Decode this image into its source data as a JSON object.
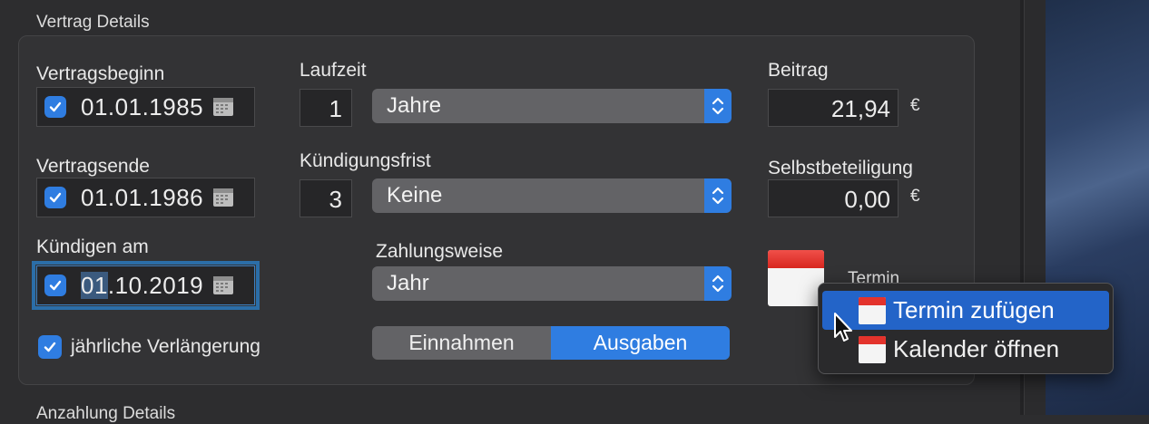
{
  "section": {
    "title": "Vertrag Details",
    "next_title": "Anzahlung Details"
  },
  "vertragsbeginn": {
    "label": "Vertragsbeginn",
    "date": "01.01.1985",
    "checked": true
  },
  "vertragsende": {
    "label": "Vertragsende",
    "date": "01.01.1986",
    "checked": true
  },
  "kuendigen": {
    "label": "Kündigen am",
    "date_selected": "01",
    "date_rest": ".10.2019",
    "checked": true
  },
  "laufzeit": {
    "label": "Laufzeit",
    "value": "1",
    "unit": "Jahre"
  },
  "kuendigungsfrist": {
    "label": "Kündigungsfrist",
    "value": "3",
    "unit": "Keine"
  },
  "zahlungsweise": {
    "label": "Zahlungsweise",
    "value": "Jahr"
  },
  "beitrag": {
    "label": "Beitrag",
    "value": "21,94",
    "currency": "€"
  },
  "selbstbeteiligung": {
    "label": "Selbstbeteiligung",
    "value": "0,00",
    "currency": "€"
  },
  "renewal": {
    "label": "jährliche Verlängerung",
    "checked": true
  },
  "type_toggle": {
    "options": [
      "Einnahmen",
      "Ausgaben"
    ],
    "selected": "Ausgaben"
  },
  "termin": {
    "label": "Termin"
  },
  "context_menu": {
    "items": [
      {
        "label": "Termin zufügen",
        "icon": "calendar-icon",
        "highlighted": true
      },
      {
        "label": "Kalender öffnen",
        "icon": "calendar-icon",
        "highlighted": false
      }
    ]
  },
  "colors": {
    "accent": "#2f7de1",
    "menu_highlight": "#2364c8",
    "calendar_red": "#e3332c"
  }
}
